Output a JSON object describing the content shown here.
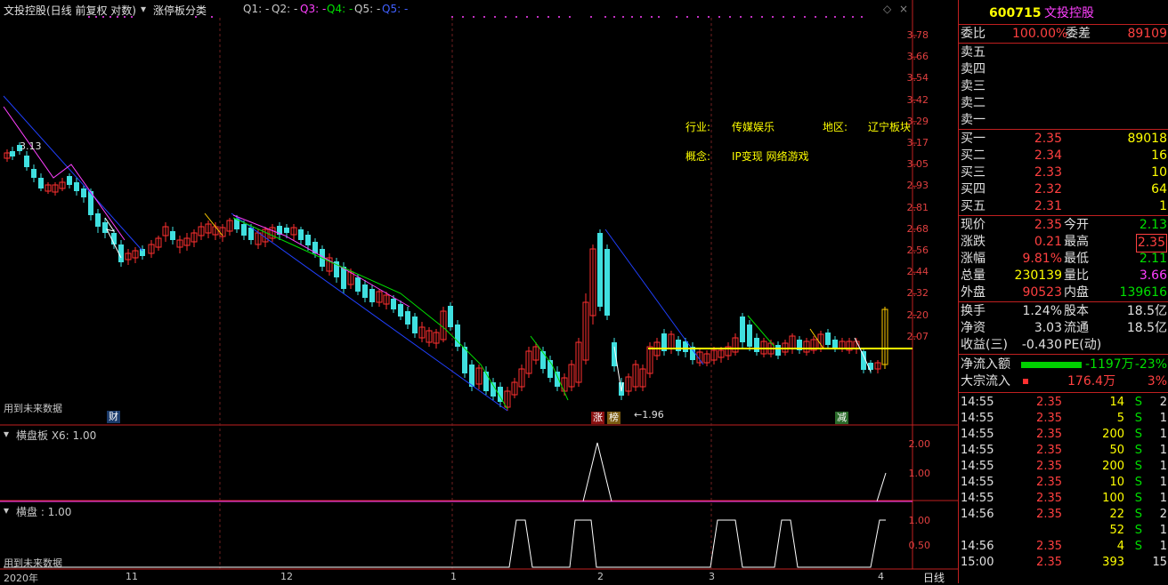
{
  "header": {
    "stock_title": "文投控股(日线 前复权 对数)",
    "indicator": "涨停板分类",
    "q_labels": [
      "Q1: -",
      "Q2: -",
      "Q3: -",
      "Q4: -",
      "Q5: -"
    ],
    "q_colors": [
      "#c8c8c8",
      "#c8c8c8",
      "#ff40ff",
      "#00e000",
      "#4060ff"
    ]
  },
  "main_chart": {
    "y_ticks": [
      "3.78",
      "3.66",
      "3.54",
      "3.42",
      "3.29",
      "3.17",
      "3.05",
      "2.93",
      "2.81",
      "2.68",
      "2.56",
      "2.44",
      "2.32",
      "2.20",
      "2.07"
    ],
    "high_label": "3.13",
    "low_label": "←1.96",
    "future_note": "用到未来数据",
    "info": {
      "industry_label": "行业:",
      "industry_value": "传媒娱乐",
      "region_label": "地区:",
      "region_value": "辽宁板块",
      "concept_label": "概念:",
      "concept_value": "IP变现 网络游戏"
    },
    "markers": {
      "cai": "财",
      "zhang": "涨",
      "bang": "榜",
      "jian": "减"
    }
  },
  "sub1": {
    "title": "横盘板  X6: 1.00",
    "ticks": [
      "2.00",
      "1.00"
    ]
  },
  "sub2": {
    "title": "横盘 : 1.00",
    "ticks": [
      "1.00",
      "0.50"
    ],
    "future_note": "用到未来数据"
  },
  "x_axis": {
    "labels": [
      "2020年",
      "11",
      "12",
      "1",
      "2",
      "3",
      "4"
    ],
    "period": "日线"
  },
  "quote": {
    "code": "600715",
    "name": "文投控股",
    "wb_label": "委比",
    "wb_value": "100.00%",
    "wc_label": "委差",
    "wc_value": "89109",
    "sell_labels": [
      "卖五",
      "卖四",
      "卖三",
      "卖二",
      "卖一"
    ],
    "buy": [
      {
        "label": "买一",
        "price": "2.35",
        "vol": "89018"
      },
      {
        "label": "买二",
        "price": "2.34",
        "vol": "16"
      },
      {
        "label": "买三",
        "price": "2.33",
        "vol": "10"
      },
      {
        "label": "买四",
        "price": "2.32",
        "vol": "64"
      },
      {
        "label": "买五",
        "price": "2.31",
        "vol": "1"
      }
    ],
    "stats": [
      {
        "l1": "现价",
        "v1": "2.35",
        "l2": "今开",
        "v2": "2.13"
      },
      {
        "l1": "涨跌",
        "v1": "0.21",
        "l2": "最高",
        "v2": "2.35"
      },
      {
        "l1": "涨幅",
        "v1": "9.81%",
        "l2": "最低",
        "v2": "2.11"
      },
      {
        "l1": "总量",
        "v1": "230139",
        "l2": "量比",
        "v2": "3.66"
      },
      {
        "l1": "外盘",
        "v1": "90523",
        "l2": "内盘",
        "v2": "139616"
      }
    ],
    "fin": [
      {
        "l1": "换手",
        "v1": "1.24%",
        "l2": "股本",
        "v2": "18.5亿"
      },
      {
        "l1": "净资",
        "v1": "3.03",
        "l2": "流通",
        "v2": "18.5亿"
      },
      {
        "l1": "收益(三)",
        "v1": "-0.430",
        "l2": "PE(动)",
        "v2": ""
      }
    ],
    "netflow_label": "净流入额",
    "netflow_value": "-1197万",
    "netflow_pct": "-23%",
    "block_label": "大宗流入",
    "block_value": "176.4万",
    "block_pct": "3%",
    "ticks": [
      {
        "time": "14:55",
        "price": "2.35",
        "vol": "14",
        "side": "S",
        "n": "2"
      },
      {
        "time": "14:55",
        "price": "2.35",
        "vol": "5",
        "side": "S",
        "n": "1"
      },
      {
        "time": "14:55",
        "price": "2.35",
        "vol": "200",
        "side": "S",
        "n": "1"
      },
      {
        "time": "14:55",
        "price": "2.35",
        "vol": "50",
        "side": "S",
        "n": "1"
      },
      {
        "time": "14:55",
        "price": "2.35",
        "vol": "200",
        "side": "S",
        "n": "1"
      },
      {
        "time": "14:55",
        "price": "2.35",
        "vol": "10",
        "side": "S",
        "n": "1"
      },
      {
        "time": "14:55",
        "price": "2.35",
        "vol": "100",
        "side": "S",
        "n": "1"
      },
      {
        "time": "14:56",
        "price": "2.35",
        "vol": "22",
        "side": "S",
        "n": "2"
      },
      {
        "time": "",
        "price": "",
        "vol": "52",
        "side": "S",
        "n": "1"
      },
      {
        "time": "14:56",
        "price": "2.35",
        "vol": "4",
        "side": "S",
        "n": "1"
      },
      {
        "time": "15:00",
        "price": "2.35",
        "vol": "393",
        "side": "",
        "n": "15"
      }
    ]
  }
}
